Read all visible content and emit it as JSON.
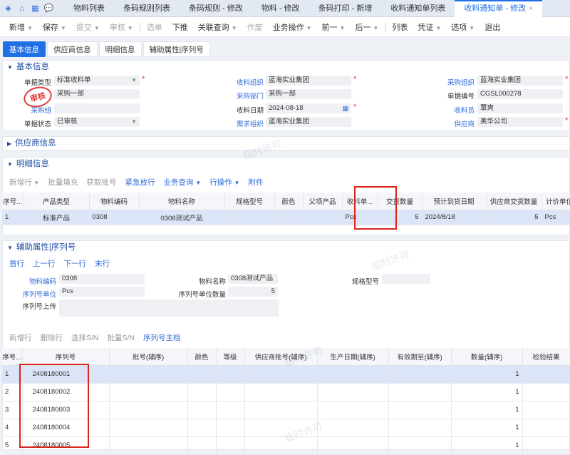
{
  "topbar": {
    "tabs": [
      {
        "label": "物料列表"
      },
      {
        "label": "条码规则列表"
      },
      {
        "label": "条码规则 - 修改"
      },
      {
        "label": "物料 - 修改"
      },
      {
        "label": "条码打印 - 新增"
      },
      {
        "label": "收料通知单列表"
      },
      {
        "label": "收料通知单 - 修改",
        "active": true
      }
    ],
    "close_glyph": "×"
  },
  "toolbar": {
    "items": [
      "新增",
      "保存",
      "提交",
      "审核",
      "选单",
      "下推",
      "关联查询",
      "作废",
      "业务操作",
      "前一",
      "后一",
      "列表",
      "凭证",
      "选项",
      "退出"
    ]
  },
  "subtabs": [
    "基本信息",
    "供应商信息",
    "明细信息",
    "辅助属性|序列号"
  ],
  "basic": {
    "title": "基本信息",
    "stamp": "审核",
    "fields": {
      "doc_type_label": "单据类型",
      "doc_type": "标准收料单",
      "recv_org_label": "收料组织",
      "recv_org": "蓝海实业集团",
      "purch_org_label": "采购组织",
      "purch_org": "蓝海实业集团",
      "purch_dept_field": "采购一部",
      "recv_dept_label": "采购部门",
      "recv_dept": "采购一部",
      "doc_no_label": "单据编号",
      "doc_no": "CGSL000278",
      "purch_group_label": "采购组",
      "recv_date_label": "收料日期",
      "recv_date": "2024-08-18",
      "receiver_label": "收料员",
      "receiver": "覃爽",
      "doc_status_label": "单据状态",
      "doc_status": "已审核",
      "demand_org_label": "需求组织",
      "demand_org": "蓝海实业集团",
      "supplier_label": "供应商",
      "supplier": "美华公司"
    }
  },
  "supplier_section": {
    "title": "供应商信息"
  },
  "detail": {
    "title": "明细信息",
    "actions": [
      "新增行",
      "批量填充",
      "获取批号",
      "紧急放行",
      "业务查询",
      "行操作",
      "附件"
    ],
    "columns": [
      "序号...",
      "产品类型",
      "物料编码",
      "物料名称",
      "规格型号",
      "颜色",
      "父项产品",
      "收料单...",
      "交货数量",
      "预计到货日期",
      "供应商交货数量",
      "计价单位"
    ],
    "rows": [
      [
        "1",
        "标准产品",
        "0308",
        "0308测试产品",
        "",
        "",
        "",
        "Pcs",
        "5",
        "2024/8/18",
        "5",
        "Pcs"
      ]
    ]
  },
  "aux": {
    "title": "辅助属性|序列号",
    "nav": [
      "首行",
      "上一行",
      "下一行",
      "末行"
    ],
    "fields": {
      "mat_code_label": "物料编码",
      "mat_code": "0308",
      "mat_name_label": "物料名称",
      "mat_name": "0308测试产品",
      "spec_label": "规格型号",
      "spec": "",
      "serial_unit_label": "序列号单位",
      "serial_unit": "Pcs",
      "serial_unit_qty_label": "序列号单位数量",
      "serial_unit_qty": "5",
      "serial_upload_label": "序列号上传"
    },
    "actions": [
      "新增行",
      "删除行",
      "选择S/N",
      "批量S/N",
      "序列号主档"
    ],
    "columns": [
      "序号...",
      "序列号",
      "批号(辅序)",
      "颜色",
      "等级",
      "供应商批号(辅序)",
      "生产日期(辅序)",
      "有效期至(辅序)",
      "数量(辅序)",
      "检验结果"
    ],
    "rows": [
      [
        "1",
        "2408180001",
        "",
        "",
        "",
        "",
        "",
        "",
        "1",
        ""
      ],
      [
        "2",
        "2408180002",
        "",
        "",
        "",
        "",
        "",
        "",
        "1",
        ""
      ],
      [
        "3",
        "2408180003",
        "",
        "",
        "",
        "",
        "",
        "",
        "1",
        ""
      ],
      [
        "4",
        "2408180004",
        "",
        "",
        "",
        "",
        "",
        "",
        "1",
        ""
      ],
      [
        "5",
        "2408180005",
        "",
        "",
        "",
        "",
        "",
        "",
        "1",
        ""
      ]
    ]
  },
  "watermark": "临时许可"
}
